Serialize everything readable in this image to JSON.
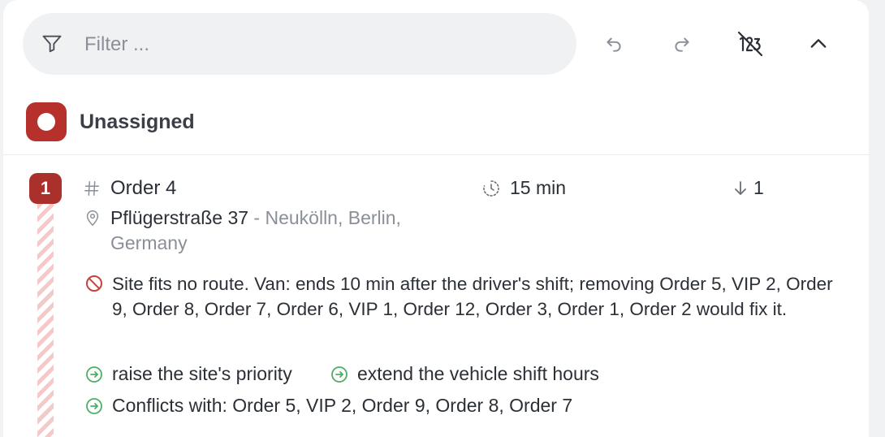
{
  "toolbar": {
    "filter_placeholder": "Filter ...",
    "icons": [
      "filter-icon",
      "undo-icon",
      "redo-icon",
      "numbers-off-icon",
      "chevron-up-icon"
    ]
  },
  "section": {
    "title": "Unassigned"
  },
  "order": {
    "index": "1",
    "name": "Order 4",
    "duration": "15 min",
    "sort_value": "1",
    "address_street": "Pflügerstraße 37",
    "address_rest_line1": " - Neukölln, Berlin,",
    "address_rest_line2": "Germany",
    "message": "Site fits no route. Van: ends 10 min after the driver's shift; removing Order 5, VIP 2, Order 9, Order 8, Order 7, Order 6, VIP 1, Order 12, Order 3, Order 1, Order 2 would fix it.",
    "suggestion_1": "raise the site's priority",
    "suggestion_2": "extend the vehicle shift hours",
    "conflicts": "Conflicts with: Order 5, VIP 2, Order 9, Order 8, Order 7"
  },
  "colors": {
    "accent_red": "#b7312c",
    "success_green": "#4caf63",
    "muted": "#8a8f98"
  }
}
